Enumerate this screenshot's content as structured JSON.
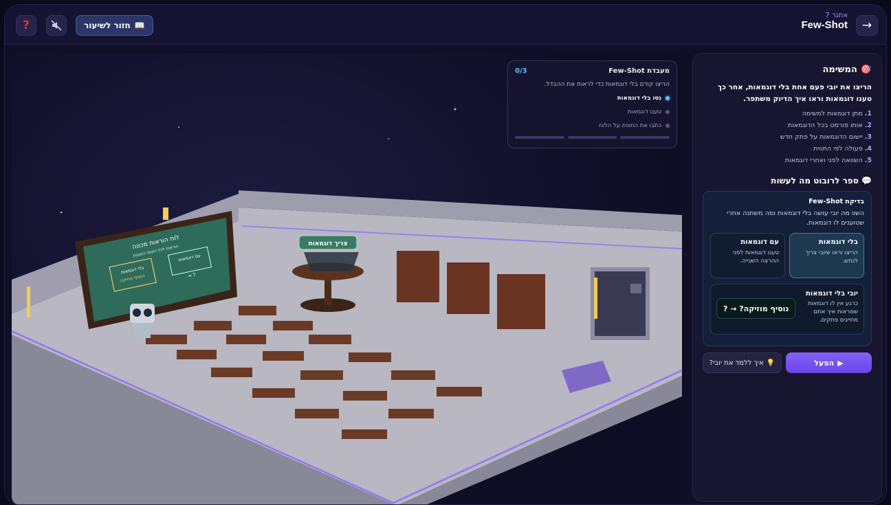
{
  "header": {
    "chapter": "אתגר 7",
    "title": "Few-Shot",
    "back_label": "חזור לשיעור",
    "help_icon": "?",
    "arrow_icon": "→"
  },
  "scene": {
    "board_title": "לוח הוראות מכונה",
    "board_sub": "הוראות לכל דוגמה כתובות",
    "board_box1": "בלי דוגמאות",
    "board_box1b": "הוסיף מוזיקה",
    "board_box2": "עם דוגמאות",
    "board_arrow": "→ ?",
    "table_sign": "צריך דוגמאות"
  },
  "lab": {
    "title": "מעבדת Few-Shot",
    "counter": "0/3",
    "description": "הריצו קודם בלי דוגמאות כדי לראות את ההבדל.",
    "steps": [
      {
        "label": "נסו בלי דוגמאות"
      },
      {
        "label": "טענו דוגמאות"
      },
      {
        "label": "כתבו את התווית על הלוח"
      }
    ]
  },
  "panel": {
    "mission_heading": "המשימה",
    "mission_text": "הריצו את יובי פעם אחת בלי דוגמאות, אחר כך טענו דוגמאות וראו איך הדיוק משתפר.",
    "steps": [
      {
        "num": "1.",
        "text": "מתן דוגמאות למשימה"
      },
      {
        "num": "2.",
        "text": "אותו פורמט בכל הדוגמאות"
      },
      {
        "num": "3.",
        "text": "יישום הדוגמאות על פתק חדש"
      },
      {
        "num": "4.",
        "text": "פעולה לפי התווית"
      },
      {
        "num": "5.",
        "text": "השוואה לפני ואחרי דוגמאות"
      }
    ],
    "tell_heading": "ספר לרובוט מה לעשות",
    "card": {
      "title": "בדיקת Few-Shot",
      "text": "השוו מה יובי עושה בלי דוגמאות ומה משתנה אחרי שטוענים לו דוגמאות.",
      "option_without_title": "בלי דוגמאות",
      "option_without_text": "הריצו וראו שיובי צריך לנחש.",
      "option_with_title": "עם דוגמאות",
      "option_with_text": "טענו דוגמאות לפני ההרצה השנייה.",
      "robot_title": "יובי בלי דוגמאות",
      "robot_text": "כרגע אין לו דוגמאות שמראות איך אתם מתייגים פתקים.",
      "robot_output": "נוסיף מוזיקה? → ?"
    },
    "run_label": "הפעל",
    "teach_label": "איך ללמד את יובי?"
  }
}
